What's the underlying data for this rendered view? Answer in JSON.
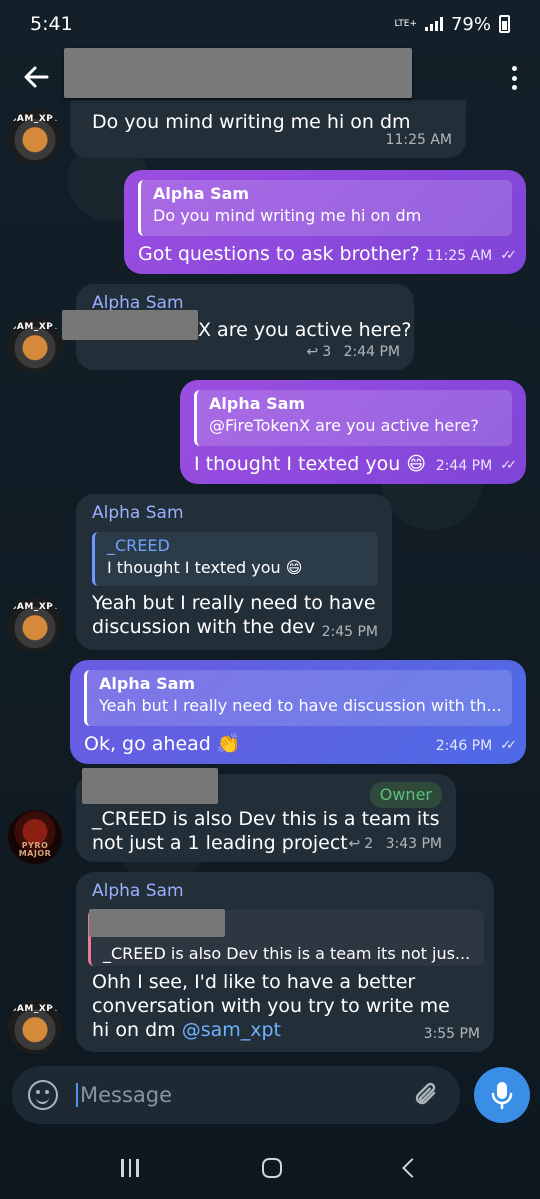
{
  "status": {
    "time": "5:41",
    "network": "LTE+",
    "battery": "79%"
  },
  "header": {
    "title": ""
  },
  "messages": [
    {
      "text": "Do you mind writing me hi on dm",
      "time": "11:25 AM",
      "avatar_text": "SAM_XPT"
    },
    {
      "reply_name": "Alpha Sam",
      "reply_text": "Do you mind writing me hi on dm",
      "text": "Got questions to ask brother?",
      "time": "11:25 AM"
    },
    {
      "sender": "Alpha Sam",
      "text": "X are you active here?",
      "replies": "3",
      "time": "2:44 PM",
      "avatar_text": "SAM_XPT"
    },
    {
      "reply_name": "Alpha Sam",
      "reply_text": "@FireTokenX are you active here?",
      "text": "I thought I texted you 😄",
      "time": "2:44 PM"
    },
    {
      "sender": "Alpha Sam",
      "reply_name": "_CREED",
      "reply_text": "I thought I texted you 😄",
      "text_line1": "Yeah but I really need to have",
      "text_line2": "discussion with the dev",
      "time": "2:45 PM",
      "avatar_text": "SAM_XPT"
    },
    {
      "reply_name": "Alpha Sam",
      "reply_text": "Yeah but I really need to have discussion with th...",
      "text": "Ok, go ahead 👏",
      "time": "2:46 PM"
    },
    {
      "badge": "Owner",
      "text_line1": "_CREED is also Dev this is a team its",
      "text_line2": "not just a 1 leading project",
      "replies": "2",
      "time": "3:43 PM",
      "avatar_text": "PYRO MAJOR"
    },
    {
      "sender": "Alpha Sam",
      "reply_text": "_CREED is also Dev this is a team its not jus...",
      "text_line1": "Ohh I see, I'd like to have a better",
      "text_line2": "conversation with you try to write me",
      "text_line3": "hi on dm ",
      "mention": "@sam_xpt",
      "time": "3:55 PM",
      "avatar_text": "SAM_XPT"
    }
  ],
  "composer": {
    "placeholder": "Message"
  },
  "icons": {
    "back": "back-arrow-icon",
    "menu": "more-vertical-icon",
    "emoji": "emoji-icon",
    "attach": "paperclip-icon",
    "mic": "microphone-icon"
  },
  "colors": {
    "outgoing_purple": "#8a49dc",
    "outgoing_blue": "#5b63e4",
    "incoming": "#222e38",
    "sender_name": "#9ab0ff",
    "owner_badge": "#5bc27a",
    "mic_button": "#3a8ee6"
  }
}
